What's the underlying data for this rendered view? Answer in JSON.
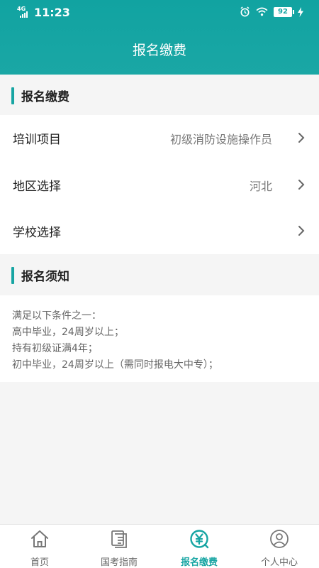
{
  "status_bar": {
    "network": "4G",
    "time": "11:23",
    "battery": "92"
  },
  "header": {
    "title": "报名缴费"
  },
  "sections": {
    "signup_title": "报名缴费",
    "notice_title": "报名须知"
  },
  "form": {
    "rows": [
      {
        "label": "培训项目",
        "value": "初级消防设施操作员"
      },
      {
        "label": "地区选择",
        "value": "河北"
      },
      {
        "label": "学校选择",
        "value": ""
      }
    ]
  },
  "notice": {
    "lines": [
      "满足以下条件之一：",
      "高中毕业，24周岁以上；",
      "持有初级证满4年；",
      "初中毕业，24周岁以上（需同时报电大中专）；"
    ]
  },
  "tabbar": {
    "items": [
      {
        "label": "首页",
        "icon": "home-icon",
        "active": false
      },
      {
        "label": "国考指南",
        "icon": "guide-document-icon",
        "active": false
      },
      {
        "label": "报名缴费",
        "icon": "yuan-payment-icon",
        "active": true
      },
      {
        "label": "个人中心",
        "icon": "user-profile-icon",
        "active": false
      }
    ]
  },
  "colors": {
    "accent": "#17a5a3",
    "background": "#f5f5f5",
    "text": "#222222",
    "muted_text": "#777777"
  }
}
